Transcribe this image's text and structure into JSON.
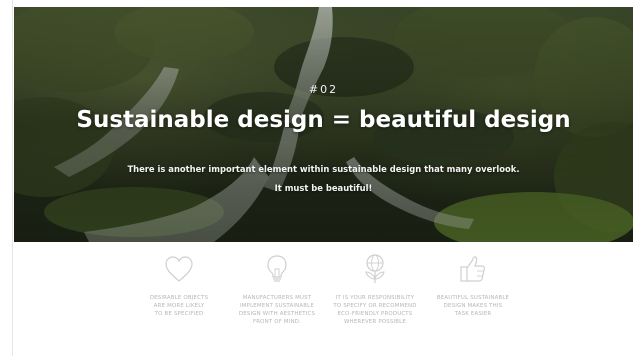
{
  "hero": {
    "kicker": "#02",
    "headline": "Sustainable design = beautiful design",
    "intro_line1": "There is another important element within sustainable design that many overlook.",
    "intro_line2": "It must be beautiful!"
  },
  "features": [
    {
      "icon": "heart-icon",
      "line1": "DESIRABLE OBJECTS",
      "line2": "ARE MORE LIKELY",
      "line3": "TO BE SPECIFIED",
      "line4": ""
    },
    {
      "icon": "lightbulb-icon",
      "line1": "MANUFACTURERS MUST",
      "line2": "IMPLEMENT SUSTAINABLE",
      "line3": "DESIGN WITH AESTHETICS",
      "line4": "FRONT OF MIND."
    },
    {
      "icon": "globe-plant-icon",
      "line1": "IT IS YOUR RESPONSIBILITY",
      "line2": "TO SPECIFY OR RECOMMEND",
      "line3": "ECO-FRIENDLY PRODUCTS",
      "line4": "WHEREVER POSSIBLE"
    },
    {
      "icon": "thumbs-up-icon",
      "line1": "BEAUTIFUL SUSTAINABLE",
      "line2": "DESIGN MAKES THIS",
      "line3": "TASK EASIER",
      "line4": ""
    }
  ],
  "colors": {
    "caption": "#b6b6b6",
    "icon_stroke": "#cfcfcf",
    "headline": "#ffffff"
  }
}
